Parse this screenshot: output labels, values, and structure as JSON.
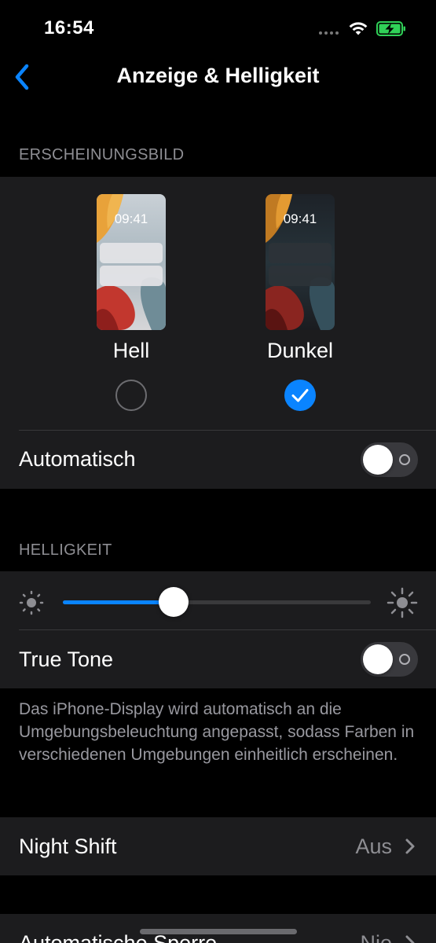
{
  "status_bar": {
    "time": "16:54",
    "wifi_icon": "wifi-icon",
    "battery_icon": "battery-charging-icon",
    "battery_color": "#30d158"
  },
  "nav": {
    "title": "Anzeige & Helligkeit",
    "back_icon": "chevron-left-icon",
    "accent": "#0a84ff"
  },
  "appearance": {
    "header": "ERSCHEINUNGSBILD",
    "options": [
      {
        "label": "Hell",
        "preview_time": "09:41",
        "selected": false
      },
      {
        "label": "Dunkel",
        "preview_time": "09:41",
        "selected": true
      }
    ],
    "automatic": {
      "label": "Automatisch",
      "on": false
    }
  },
  "brightness": {
    "header": "HELLIGKEIT",
    "level": 0.36,
    "true_tone": {
      "label": "True Tone",
      "on": false
    },
    "footnote": "Das iPhone-Display wird automatisch an die Umgebungsbeleuchtung angepasst, sodass Farben in verschiedenen Umgebungen einheitlich erscheinen."
  },
  "night_shift": {
    "label": "Night Shift",
    "value": "Aus"
  },
  "auto_lock": {
    "label": "Automatische Sperre",
    "value": "Nie"
  }
}
